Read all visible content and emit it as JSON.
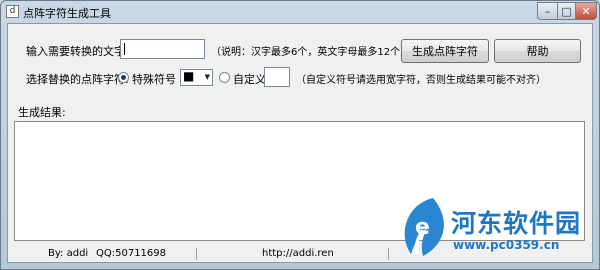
{
  "window": {
    "title": "点阵字符生成工具",
    "icon_text": "d",
    "controls": {
      "minimize": "–",
      "maximize": "□",
      "close": "✕"
    }
  },
  "input_row": {
    "label": "输入需要转换的文字:",
    "value": "",
    "note": "（说明：汉字最多6个，英文字母最多12个）"
  },
  "buttons": {
    "generate": "生成点阵字符",
    "help": "帮助"
  },
  "symbol_row": {
    "label": "选择替换的点阵字符:",
    "special_label": "特殊符号",
    "special_checked": true,
    "selected_symbol": "■",
    "custom_label": "自定义:",
    "custom_checked": false,
    "custom_value": "",
    "note": "（自定义符号请选用宽字符，否则生成结果可能不对齐）"
  },
  "result": {
    "label": "生成结果:",
    "content": ""
  },
  "statusbar": {
    "author": "By: addi",
    "qq": "QQ:50711698",
    "url": "http://addi.ren"
  },
  "watermark": {
    "text": "河东软件园",
    "url": "www.pc0359.cn",
    "color": "#1f77c4"
  }
}
